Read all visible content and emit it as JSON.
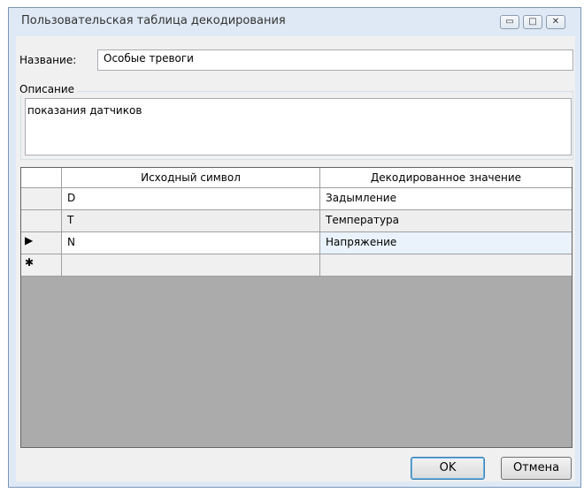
{
  "window": {
    "title": "Пользовательская таблица декодирования",
    "minimize_glyph": "▭",
    "maximize_glyph": "□",
    "close_glyph": "✕"
  },
  "form": {
    "name_label": "Название:",
    "name_value": "Особые тревоги",
    "description_label": "Описание",
    "description_value": "показания датчиков"
  },
  "grid": {
    "columns": [
      "Исходный символ",
      "Декодированное значение"
    ],
    "rows": [
      {
        "indicator": "",
        "source": "D",
        "value": "Задымление"
      },
      {
        "indicator": "",
        "source": "T",
        "value": "Температура"
      },
      {
        "indicator": "▶",
        "source": "N",
        "value": "Напряжение"
      },
      {
        "indicator": "✱",
        "source": "",
        "value": ""
      }
    ],
    "selected_row": 2
  },
  "buttons": {
    "ok_label": "OK",
    "cancel_label": "Отмена"
  }
}
